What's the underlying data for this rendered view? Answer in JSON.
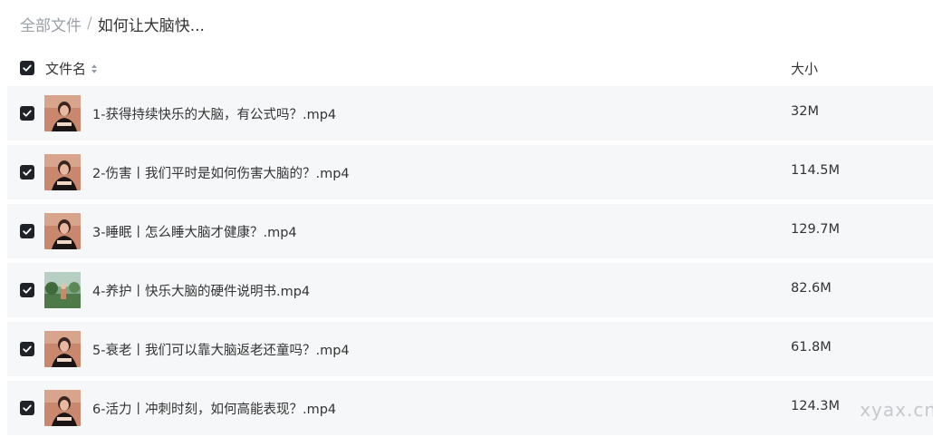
{
  "breadcrumb": {
    "root": "全部文件",
    "separator": "/",
    "current": "如何让大脑快..."
  },
  "header": {
    "name_label": "文件名",
    "size_label": "大小"
  },
  "files": [
    {
      "name": "1-获得持续快乐的大脑，有公式吗？.mp4",
      "size": "32M",
      "thumb": "presenter"
    },
    {
      "name": "2-伤害丨我们平时是如何伤害大脑的？.mp4",
      "size": "114.5M",
      "thumb": "presenter"
    },
    {
      "name": "3-睡眠丨怎么睡大脑才健康？.mp4",
      "size": "129.7M",
      "thumb": "presenter"
    },
    {
      "name": "4-养护丨快乐大脑的硬件说明书.mp4",
      "size": "82.6M",
      "thumb": "outdoor"
    },
    {
      "name": "5-衰老丨我们可以靠大脑返老还童吗？.mp4",
      "size": "61.8M",
      "thumb": "presenter"
    },
    {
      "name": "6-活力丨冲刺时刻，如何高能表现？.mp4",
      "size": "124.3M",
      "thumb": "presenter"
    }
  ],
  "watermark": "xyax.cn",
  "colors": {
    "row_background": "#f6f7f8",
    "checkbox": "#1f2329",
    "breadcrumb_root": "#9aa0a6"
  }
}
